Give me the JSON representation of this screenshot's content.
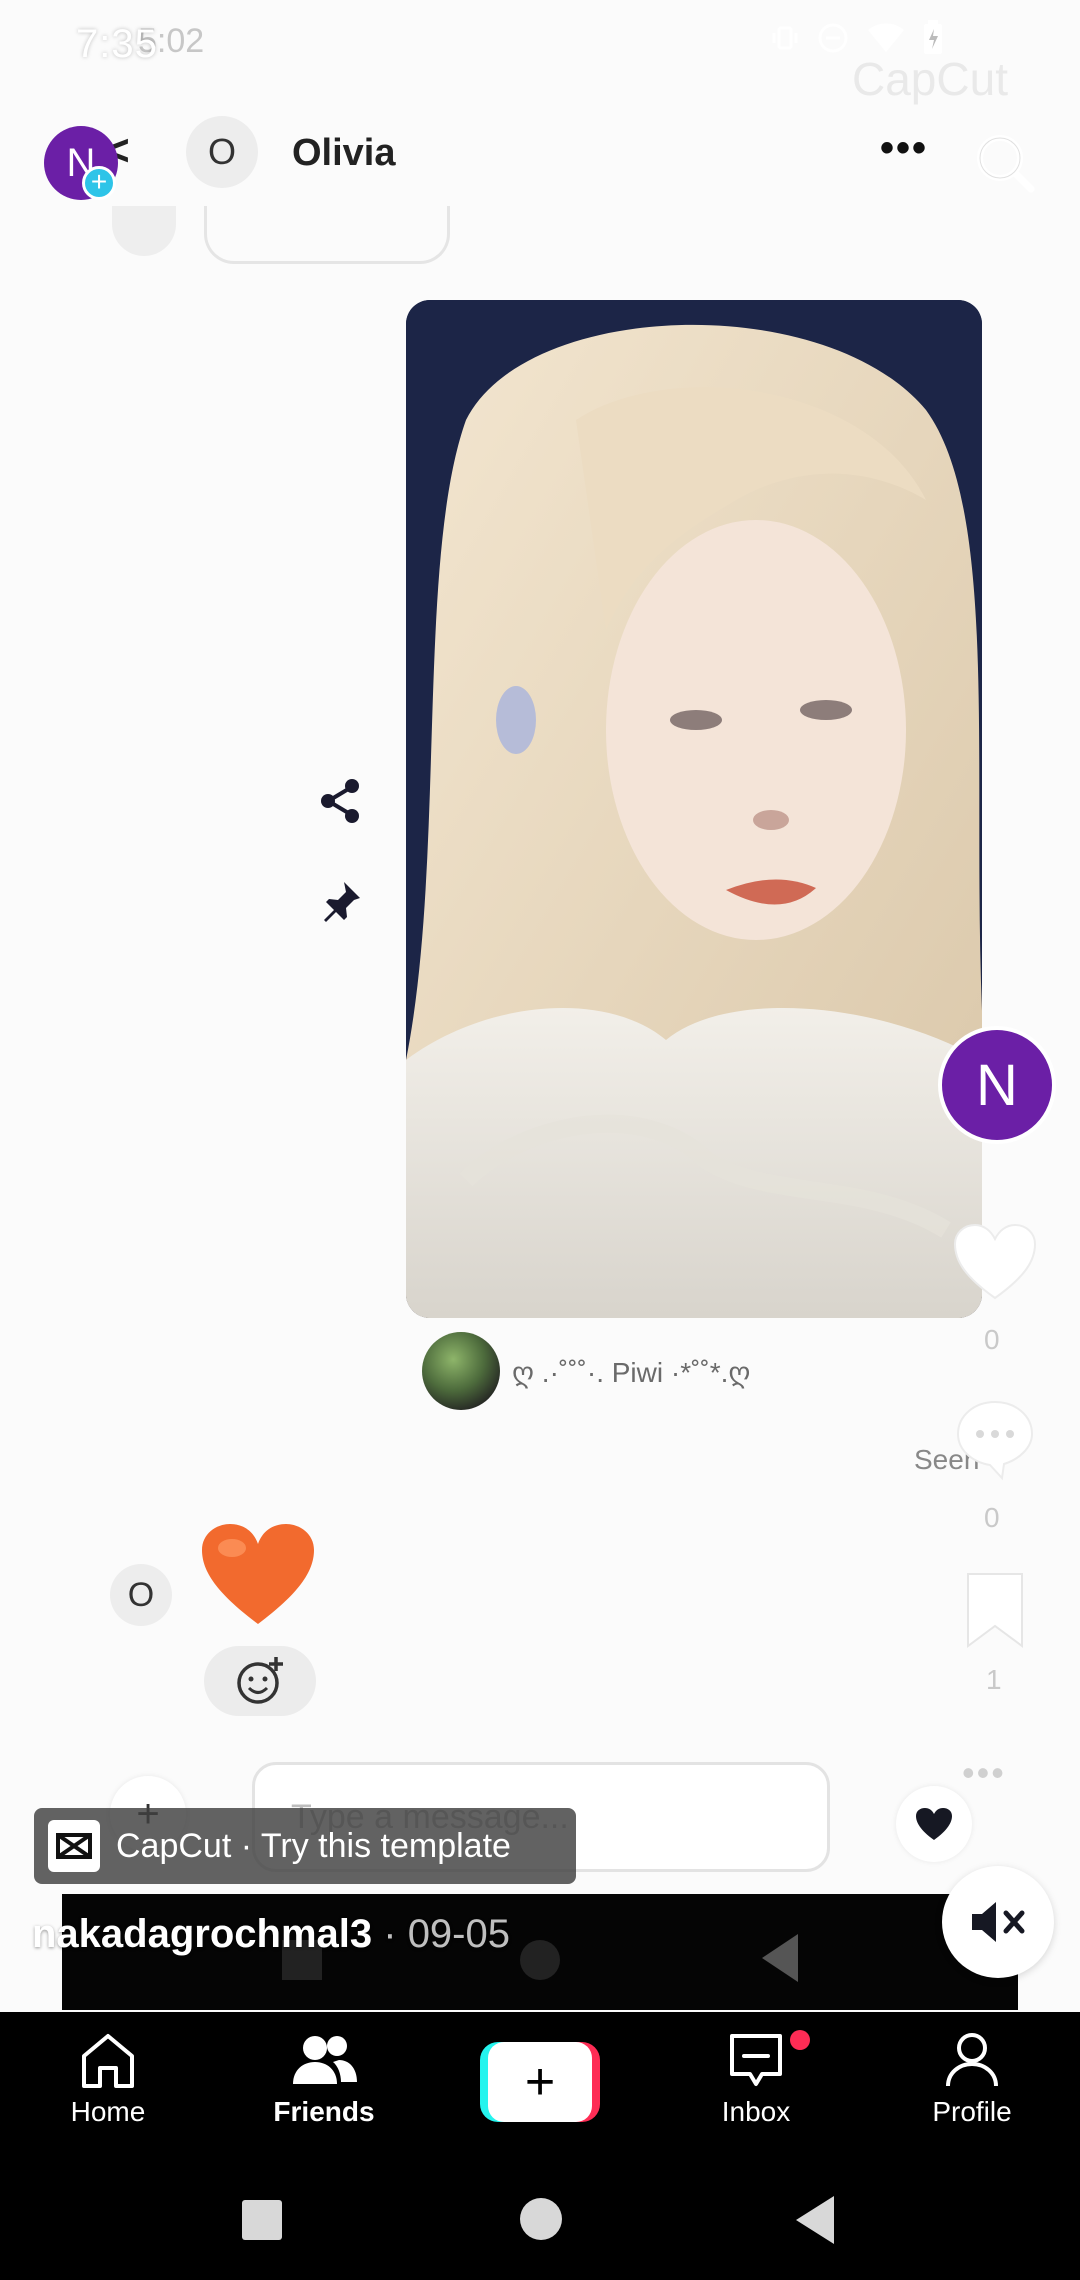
{
  "status_bar": {
    "time": "7:35",
    "ghost_time": "5:02"
  },
  "watermark": "CapCut",
  "chat_header": {
    "avatar_letter": "N",
    "contact_avatar_label": "O",
    "contact_name": "Olivia",
    "more_label": "•••"
  },
  "shared_video": {
    "caption": "ღ .·˚˚˚·. Piwi  ·*˚˚*.ღ",
    "seen_label": "Seen"
  },
  "received_message": {
    "avatar_label": "O"
  },
  "composer": {
    "plus_label": "+",
    "placeholder": "Type a message..."
  },
  "rail": {
    "avatar_letter": "N",
    "like_count": "0",
    "comment_count": "0",
    "save_count": "1",
    "more_label": "•••"
  },
  "capcut_banner": {
    "text": "CapCut · Try this template"
  },
  "post": {
    "author": "nakadagrochmal3",
    "date": " · 09-05"
  },
  "tabs": {
    "home": "Home",
    "friends": "Friends",
    "create": "+",
    "inbox": "Inbox",
    "profile": "Profile"
  },
  "colors": {
    "avatar_purple": "#6b1fa6",
    "tiktok_cyan": "#25f4ee",
    "tiktok_red": "#fe2c55",
    "heart_orange": "#f26a2e"
  },
  "icons": [
    "search-icon",
    "share-icon",
    "pin-icon",
    "heart-icon",
    "comment-icon",
    "bookmark-icon",
    "mute-icon",
    "home-icon",
    "friends-icon",
    "inbox-icon",
    "profile-icon"
  ]
}
